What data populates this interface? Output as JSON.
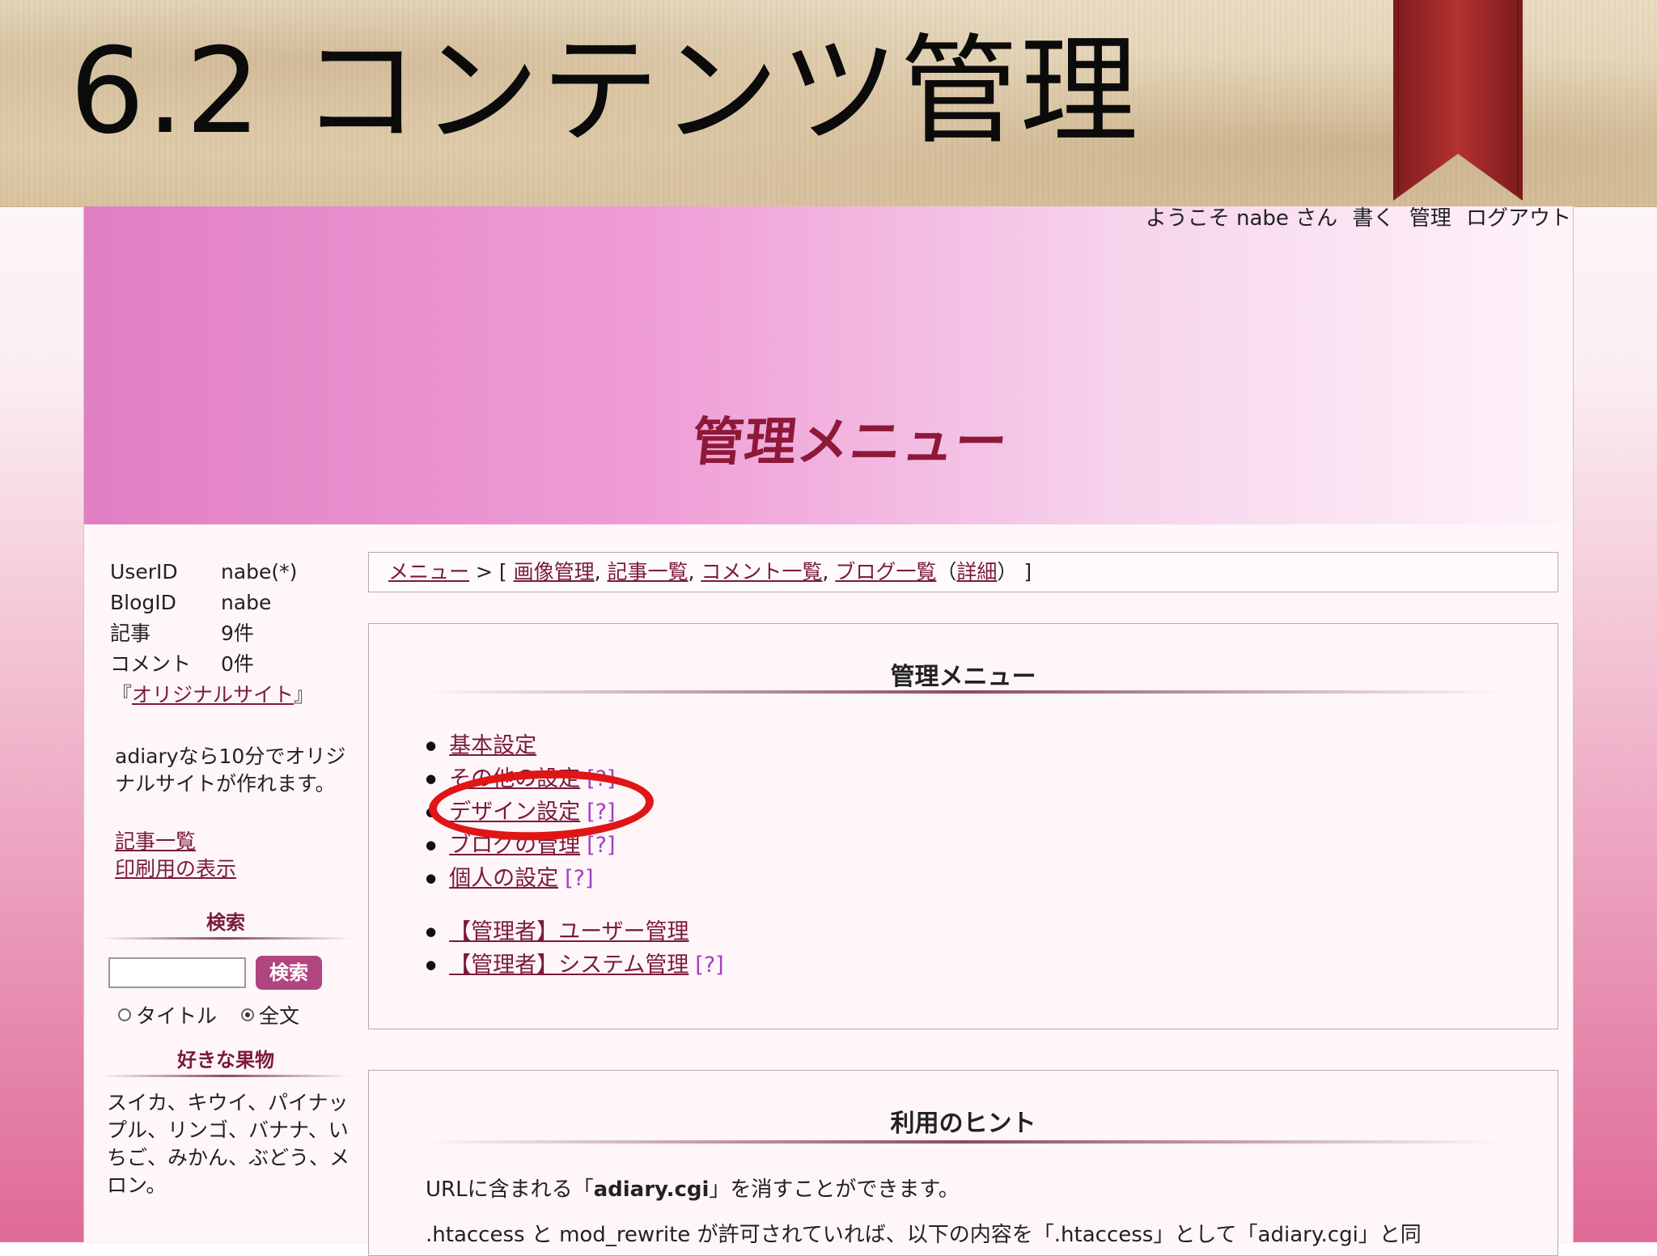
{
  "slide": {
    "title": "6.2 コンテンツ管理"
  },
  "user_nav": {
    "welcome": "ようこそ nabe さん",
    "write": "書く",
    "manage": "管理",
    "logout": "ログアウト"
  },
  "banner": {
    "title": "管理メニュー"
  },
  "sidebar": {
    "profile": [
      {
        "key": "UserID",
        "value": "nabe(*)"
      },
      {
        "key": "BlogID",
        "value": "nabe"
      },
      {
        "key": "記事",
        "value": "9件"
      },
      {
        "key": "コメント",
        "value": "0件"
      }
    ],
    "original_site": {
      "open": "『",
      "label": "オリジナルサイト",
      "close": "』"
    },
    "promo": "adiaryなら10分でオリジナルサイトが作れます。",
    "links": [
      "記事一覧",
      "印刷用の表示"
    ],
    "search": {
      "heading": "検索",
      "button": "検索",
      "input_value": "",
      "radio_title": "タイトル",
      "radio_fulltext": "全文",
      "selected": "全文"
    },
    "fruits": {
      "heading": "好きな果物",
      "text": "スイカ、キウイ、パイナップル、リンゴ、バナナ、いちご、みかん、ぶどう、メロン。"
    }
  },
  "breadcrumb": {
    "menu": "メニュー",
    "sep": " > [ ",
    "items": [
      "画像管理",
      "記事一覧",
      "コメント一覧",
      "ブログ一覧"
    ],
    "detail": "詳細",
    "end": " ]"
  },
  "admin_panel": {
    "title": "管理メニュー",
    "help_label": "[?]",
    "items": [
      "基本設定",
      "その他の設定",
      "デザイン設定",
      "ブログの管理",
      "個人の設定"
    ],
    "admin_items": [
      "【管理者】ユーザー管理",
      "【管理者】システム管理"
    ]
  },
  "hints_panel": {
    "title": "利用のヒント",
    "line1_pre": "URLに含まれる「",
    "line1_bold": "adiary.cgi",
    "line1_post": "」を消すことができます。",
    "line2": ".htaccess と mod_rewrite が許可されていれば、以下の内容を「.htaccess」として「adiary.cgi」と同"
  },
  "colors": {
    "accent": "#8e1838",
    "link": "#7a1b3a",
    "help": "#a23fc0",
    "highlight": "#e01515"
  }
}
